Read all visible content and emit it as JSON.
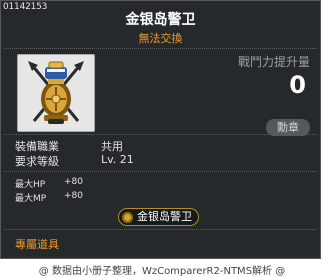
{
  "item": {
    "id": "01142153",
    "name": "金银岛警卫",
    "trade": "無法交換"
  },
  "power": {
    "label": "戰鬥力提升量",
    "value": "0"
  },
  "medal_button": "勳章",
  "requirements": {
    "job_label": "裝備職業",
    "job_value": "共用",
    "level_label": "要求等級",
    "level_value": "Lv. 21"
  },
  "stats": [
    {
      "label": "最大HP",
      "value": "+80"
    },
    {
      "label": "最大MP",
      "value": "+80"
    }
  ],
  "set_name": "金银岛警卫",
  "exclusive": "專屬道具",
  "footer": "@ 数据由小册子整理，WzComparerR2-NTMS解析 @",
  "colors": {
    "background": "#26292c",
    "accent_orange": "#f09a28",
    "text": "#ffffff"
  },
  "icons": [
    "medal-helmet-icon",
    "coin-icon"
  ]
}
